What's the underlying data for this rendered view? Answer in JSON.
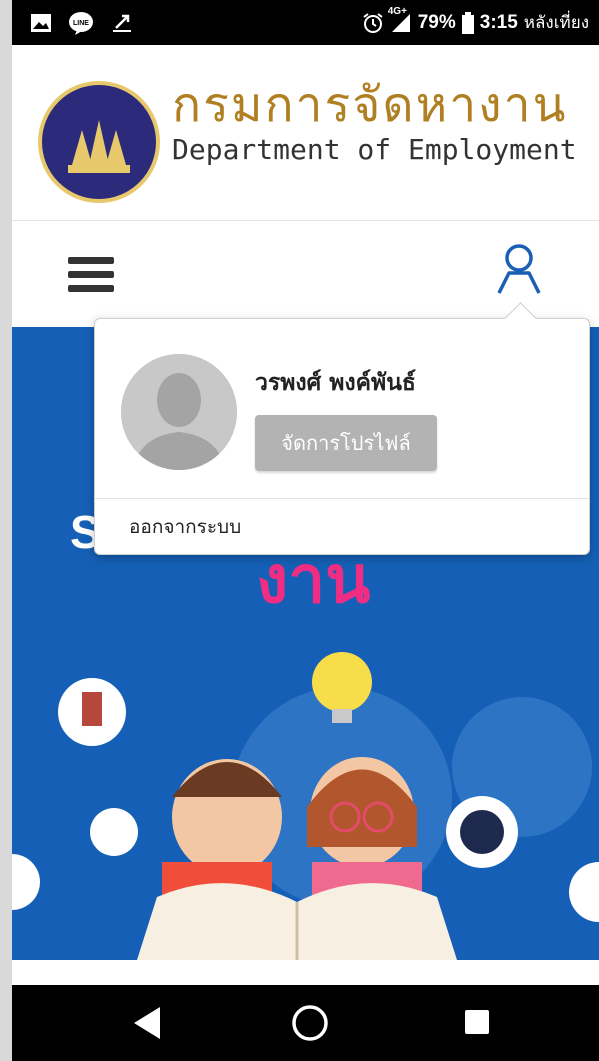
{
  "status_bar": {
    "left_icons": [
      "image-icon",
      "line-app-icon",
      "notification-arrow-icon"
    ],
    "alarm_icon": "alarm-clock-icon",
    "network": "4G+",
    "battery": "79%",
    "time": "3:15",
    "time_suffix": "หลังเที่ยง"
  },
  "header": {
    "title_th": "กรมการจัดหางาน",
    "title_en": "Department of Employment"
  },
  "nav": {
    "menu_icon": "hamburger-icon",
    "user_icon": "user-icon"
  },
  "banner": {
    "partial_letter": "S",
    "title_partial": "งาน"
  },
  "popup": {
    "user_name": "วรพงศ์ พงค์พันธ์",
    "manage_profile": "จัดการโปรไฟล์",
    "logout": "ออกจากระบบ"
  },
  "system_nav": {
    "back": "back-icon",
    "home": "home-icon",
    "recents": "recents-icon"
  },
  "colors": {
    "banner_blue": "#1560b6",
    "title_gold": "#b07f22",
    "banner_pink": "#ef2e83"
  }
}
